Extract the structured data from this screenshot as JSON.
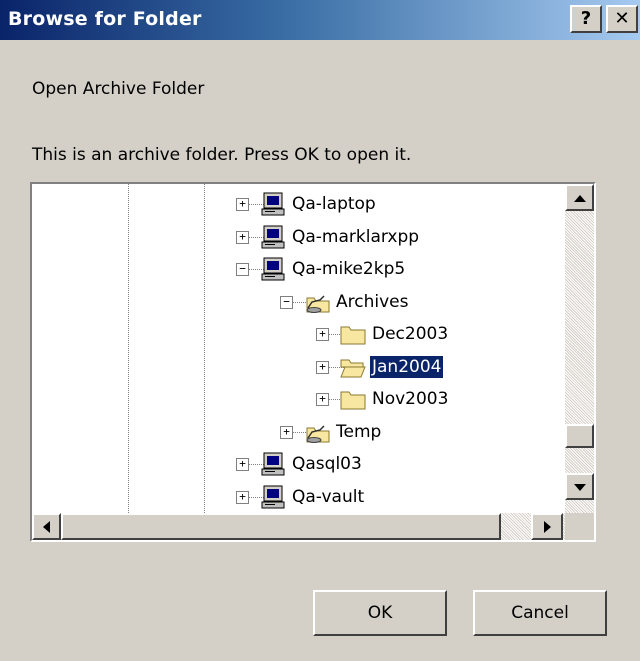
{
  "window": {
    "title": "Browse for Folder",
    "help_label": "?",
    "close_label": "✕"
  },
  "dialog": {
    "heading": "Open Archive Folder",
    "message": "This is an archive folder. Press OK to open it."
  },
  "tree": {
    "nodes": [
      {
        "label": "Qa-laptop",
        "icon": "computer-icon",
        "expander": "+",
        "depth": 0,
        "selected": false
      },
      {
        "label": "Qa-marklarxpp",
        "icon": "computer-icon",
        "expander": "+",
        "depth": 0,
        "selected": false
      },
      {
        "label": "Qa-mike2kp5",
        "icon": "computer-icon",
        "expander": "−",
        "depth": 0,
        "selected": false
      },
      {
        "label": "Archives",
        "icon": "shared-folder-icon",
        "expander": "−",
        "depth": 1,
        "selected": false
      },
      {
        "label": "Dec2003",
        "icon": "folder-icon",
        "expander": "+",
        "depth": 2,
        "selected": false
      },
      {
        "label": "Jan2004",
        "icon": "open-folder-icon",
        "expander": "+",
        "depth": 2,
        "selected": true
      },
      {
        "label": "Nov2003",
        "icon": "folder-icon",
        "expander": "+",
        "depth": 2,
        "selected": false
      },
      {
        "label": "Temp",
        "icon": "shared-folder-icon",
        "expander": "+",
        "depth": 1,
        "selected": false
      },
      {
        "label": "Qasql03",
        "icon": "computer-icon",
        "expander": "+",
        "depth": 0,
        "selected": false
      },
      {
        "label": "Qa-vault",
        "icon": "computer-icon",
        "expander": "+",
        "depth": 0,
        "selected": false
      }
    ]
  },
  "buttons": {
    "ok_label": "OK",
    "cancel_label": "Cancel"
  },
  "colors": {
    "title_start": "#0a246a",
    "title_end": "#a6caf0",
    "selection": "#0a246a",
    "dialog_bg": "#d4d0c8"
  }
}
